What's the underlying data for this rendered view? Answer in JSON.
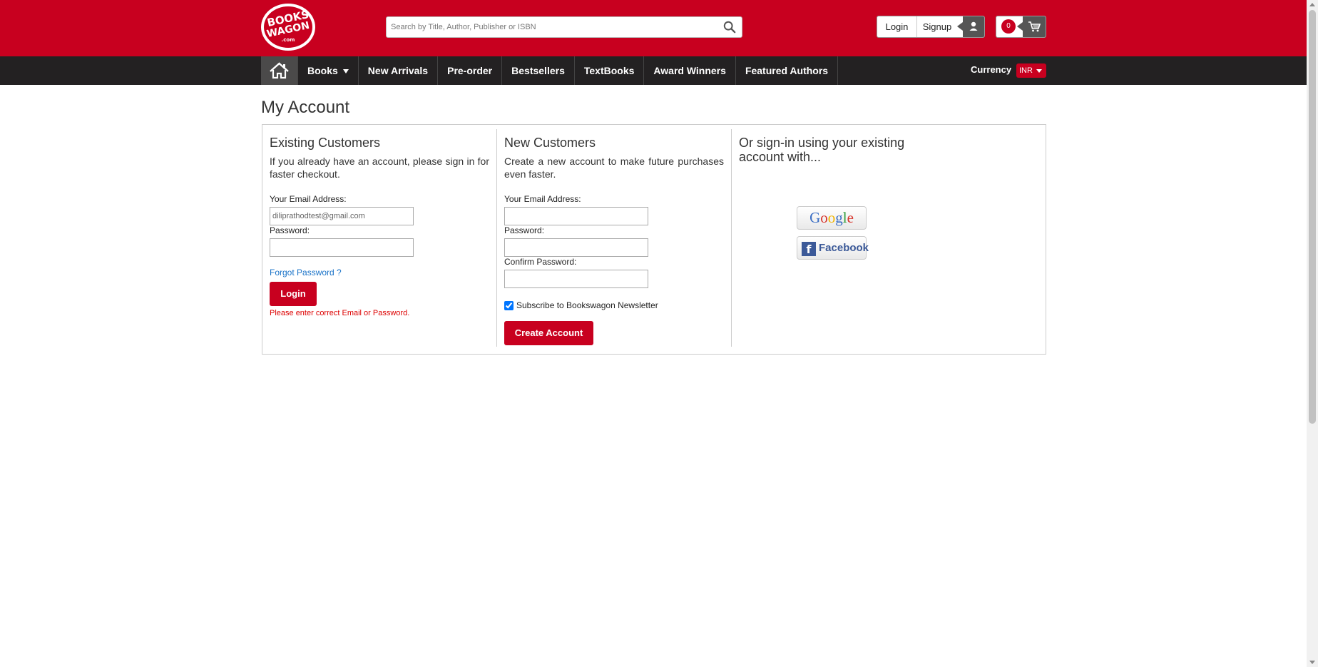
{
  "header": {
    "logo": {
      "line1": "BOOKS",
      "line2": "WAGON",
      "line3": ".com"
    },
    "search": {
      "placeholder": "Search by Title, Author, Publisher or ISBN",
      "icon": "search-icon"
    },
    "auth": {
      "login_label": "Login",
      "signup_label": "Signup",
      "icon": "user-icon"
    },
    "cart": {
      "count": "0",
      "icon": "cart-icon"
    }
  },
  "nav": {
    "home_icon": "home-icon",
    "items": [
      "Books",
      "New Arrivals",
      "Pre-order",
      "Bestsellers",
      "TextBooks",
      "Award Winners",
      "Featured Authors"
    ],
    "currency_label": "Currency",
    "currency_value": "INR"
  },
  "main": {
    "title": "My Account",
    "existing": {
      "heading": "Existing Customers",
      "description": "If you already have an account, please sign in for faster checkout.",
      "email_label": "Your Email Address:",
      "email_value": "diliprathodtest@gmail.com",
      "password_label": "Password:",
      "forgot_label": "Forgot Password ?",
      "login_label": "Login",
      "error_text": "Please enter correct Email or Password."
    },
    "new": {
      "heading": "New Customers",
      "description": "Create a new account to make future purchases even faster.",
      "email_label": "Your Email Address:",
      "password_label": "Password:",
      "confirm_label": "Confirm Password:",
      "subscribe_label": "Subscribe to Bookswagon Newsletter",
      "create_label": "Create Account"
    },
    "social": {
      "heading": "Or sign-in using your existing account with...",
      "google_label": "Google",
      "facebook_label": "Facebook"
    }
  },
  "colors": {
    "brand_red": "#c8001f",
    "nav_dark": "#232122",
    "link_blue": "#1a73c8",
    "error_red": "#dd0000"
  }
}
